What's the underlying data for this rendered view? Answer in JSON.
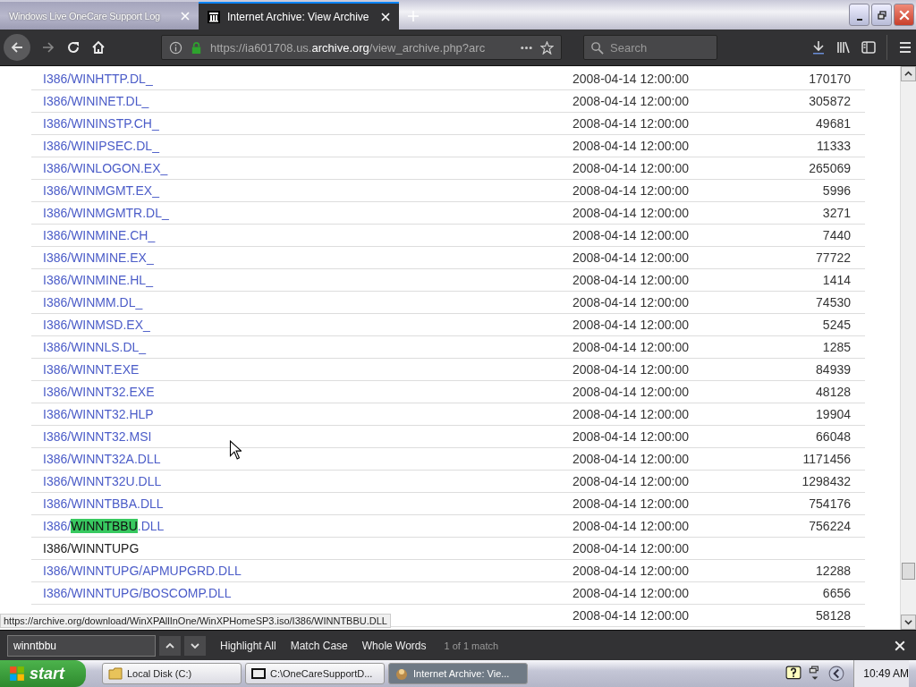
{
  "tabs": [
    {
      "title": "Windows Live OneCare Support Log",
      "selected": false
    },
    {
      "title": "Internet Archive: View Archive",
      "selected": true
    }
  ],
  "toolbar": {
    "url_prefix": "https://ia601708.us.",
    "url_domain": "archive.org",
    "url_path": "/view_archive.php?arc",
    "search_placeholder": "Search"
  },
  "rows": [
    {
      "kind": "file",
      "name": "I386/WINHTTP.DL_",
      "date": "2008-04-14 12:00:00",
      "size": "170170"
    },
    {
      "kind": "file",
      "name": "I386/WININET.DL_",
      "date": "2008-04-14 12:00:00",
      "size": "305872"
    },
    {
      "kind": "file",
      "name": "I386/WININSTP.CH_",
      "date": "2008-04-14 12:00:00",
      "size": "49681"
    },
    {
      "kind": "file",
      "name": "I386/WINIPSEC.DL_",
      "date": "2008-04-14 12:00:00",
      "size": "11333"
    },
    {
      "kind": "file",
      "name": "I386/WINLOGON.EX_",
      "date": "2008-04-14 12:00:00",
      "size": "265069"
    },
    {
      "kind": "file",
      "name": "I386/WINMGMT.EX_",
      "date": "2008-04-14 12:00:00",
      "size": "5996"
    },
    {
      "kind": "file",
      "name": "I386/WINMGMTR.DL_",
      "date": "2008-04-14 12:00:00",
      "size": "3271"
    },
    {
      "kind": "file",
      "name": "I386/WINMINE.CH_",
      "date": "2008-04-14 12:00:00",
      "size": "7440"
    },
    {
      "kind": "file",
      "name": "I386/WINMINE.EX_",
      "date": "2008-04-14 12:00:00",
      "size": "77722"
    },
    {
      "kind": "file",
      "name": "I386/WINMINE.HL_",
      "date": "2008-04-14 12:00:00",
      "size": "1414"
    },
    {
      "kind": "file",
      "name": "I386/WINMM.DL_",
      "date": "2008-04-14 12:00:00",
      "size": "74530"
    },
    {
      "kind": "file",
      "name": "I386/WINMSD.EX_",
      "date": "2008-04-14 12:00:00",
      "size": "5245"
    },
    {
      "kind": "file",
      "name": "I386/WINNLS.DL_",
      "date": "2008-04-14 12:00:00",
      "size": "1285"
    },
    {
      "kind": "file",
      "name": "I386/WINNT.EXE",
      "date": "2008-04-14 12:00:00",
      "size": "84939"
    },
    {
      "kind": "file",
      "name": "I386/WINNT32.EXE",
      "date": "2008-04-14 12:00:00",
      "size": "48128"
    },
    {
      "kind": "file",
      "name": "I386/WINNT32.HLP",
      "date": "2008-04-14 12:00:00",
      "size": "19904"
    },
    {
      "kind": "file",
      "name": "I386/WINNT32.MSI",
      "date": "2008-04-14 12:00:00",
      "size": "66048"
    },
    {
      "kind": "file",
      "name": "I386/WINNT32A.DLL",
      "date": "2008-04-14 12:00:00",
      "size": "1171456"
    },
    {
      "kind": "file",
      "name": "I386/WINNT32U.DLL",
      "date": "2008-04-14 12:00:00",
      "size": "1298432"
    },
    {
      "kind": "file",
      "name": "I386/WINNTBBA.DLL",
      "date": "2008-04-14 12:00:00",
      "size": "754176"
    },
    {
      "kind": "file",
      "name": "I386/",
      "match": "WINNTBBU",
      "name_rest": ".DLL",
      "date": "2008-04-14 12:00:00",
      "size": "756224"
    },
    {
      "kind": "folder",
      "name": "I386/WINNTUPG",
      "date": "2008-04-14 12:00:00"
    },
    {
      "kind": "file",
      "name": "I386/WINNTUPG/APMUPGRD.DLL",
      "date": "2008-04-14 12:00:00",
      "size": "12288"
    },
    {
      "kind": "file",
      "name": "I386/WINNTUPG/BOSCOMP.DLL",
      "date": "2008-04-14 12:00:00",
      "size": "6656"
    },
    {
      "kind": "file",
      "date": "2008-04-14 12:00:00",
      "size": "58128"
    }
  ],
  "status_link": "https://archive.org/download/WinXPAllInOne/WinXPHomeSP3.iso/I386/WINNTBBU.DLL",
  "find_bar": {
    "query": "winntbbu",
    "options": [
      {
        "label": "Highlight All",
        "checked": false
      },
      {
        "label": "Match Case",
        "checked": false
      },
      {
        "label": "Whole Words",
        "checked": false
      }
    ],
    "result": "1 of 1 match"
  },
  "taskbar": {
    "start": "start",
    "tasks": [
      {
        "label": "Local Disk (C:)",
        "selected": false
      },
      {
        "label": "C:\\OneCareSupportD...",
        "selected": false
      },
      {
        "label": "Internet Archive: Vie...",
        "selected": true
      }
    ],
    "clock": "10:49 AM"
  }
}
